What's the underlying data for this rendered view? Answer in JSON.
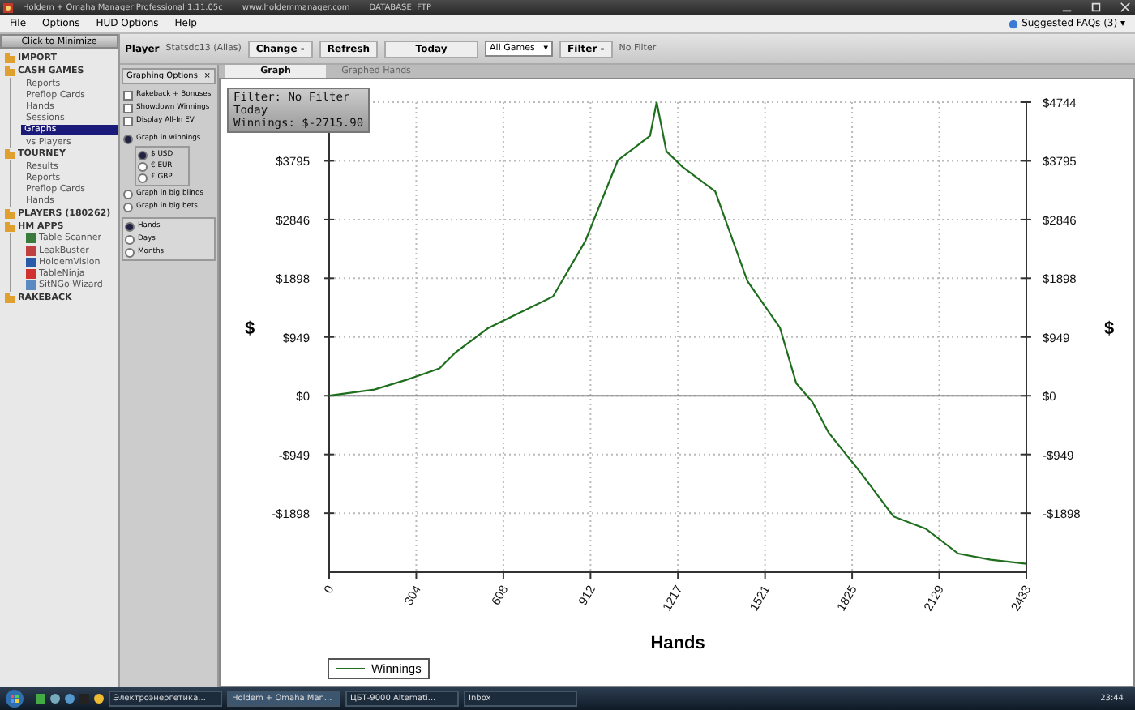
{
  "window": {
    "title": "Holdem + Omaha Manager Professional 1.11.05c",
    "site": "www.holdemmanager.com",
    "database": "DATABASE: FTP"
  },
  "menu": [
    "File",
    "Options",
    "HUD Options",
    "Help"
  ],
  "faq": "Suggested FAQs (3)",
  "faq_arrow": "▾",
  "minimize_button": "Click to Minimize",
  "sidebar": [
    {
      "label": "IMPORT"
    },
    {
      "label": "CASH GAMES",
      "children": [
        {
          "label": "Reports",
          "selected": false
        },
        {
          "label": "Preflop Cards",
          "selected": false
        },
        {
          "label": "Hands",
          "selected": false
        },
        {
          "label": "Sessions",
          "selected": false
        },
        {
          "label": "Graphs",
          "selected": true
        },
        {
          "label": "vs Players",
          "selected": false
        }
      ]
    },
    {
      "label": "TOURNEY",
      "children": [
        {
          "label": "Results",
          "selected": false
        },
        {
          "label": "Reports",
          "selected": false
        },
        {
          "label": "Preflop Cards",
          "selected": false
        },
        {
          "label": "Hands",
          "selected": false
        }
      ]
    },
    {
      "label": "PLAYERS (180262)"
    },
    {
      "label": "HM APPS",
      "children": [
        {
          "label": "Table Scanner",
          "selected": false,
          "color": "#3a7a3a"
        },
        {
          "label": "LeakBuster",
          "selected": false,
          "color": "#c04040"
        },
        {
          "label": "HoldemVision",
          "selected": false,
          "color": "#2a5aa8"
        },
        {
          "label": "TableNinja",
          "selected": false,
          "color": "#d03030"
        },
        {
          "label": "SitNGo Wizard",
          "selected": false,
          "color": "#5a8ac0"
        }
      ]
    },
    {
      "label": "RAKEBACK"
    }
  ],
  "toolbar": {
    "player_label": "Player",
    "player": "Statsdc13 (Alias)",
    "change": "Change -",
    "refresh": "Refresh",
    "today": "Today",
    "games": "All Games",
    "games_arrow": "▾",
    "filter": "Filter -",
    "filter_value": "No Filter"
  },
  "options": {
    "title": "Graphing Options",
    "close": "×",
    "checks": [
      {
        "label": "Rakeback + Bonuses",
        "checked": false
      },
      {
        "label": "Showdown Winnings",
        "checked": false
      },
      {
        "label": "Display All-In EV",
        "checked": false
      }
    ],
    "modes": [
      {
        "label": "Graph in winnings",
        "selected": true,
        "currencies": [
          {
            "label": "$ USD",
            "selected": true
          },
          {
            "label": "€ EUR",
            "selected": false
          },
          {
            "label": "£ GBP",
            "selected": false
          }
        ]
      },
      {
        "label": "Graph in big blinds",
        "selected": false
      },
      {
        "label": "Graph in big bets",
        "selected": false
      }
    ],
    "periods": [
      {
        "label": "Hands",
        "selected": true
      },
      {
        "label": "Days",
        "selected": false
      },
      {
        "label": "Months",
        "selected": false
      }
    ]
  },
  "tabs": [
    {
      "label": "Graph",
      "selected": true
    },
    {
      "label": "Graphed Hands",
      "selected": false
    }
  ],
  "info": [
    "Filter: No Filter",
    "Today",
    "Winnings: $-2715.90"
  ],
  "chart_data": {
    "type": "line",
    "xlabel": "Hands",
    "ylabel": "$",
    "x": [
      0,
      158,
      272,
      385,
      441,
      554,
      668,
      781,
      894,
      1007,
      1120,
      1143,
      1177,
      1233,
      1347,
      1460,
      1573,
      1630,
      1686,
      1743,
      1856,
      1969,
      2082,
      2195,
      2308,
      2433
    ],
    "series": [
      {
        "name": "Winnings",
        "color": "#1e6e1e",
        "values": [
          0,
          100,
          260,
          440,
          700,
          1090,
          1350,
          1600,
          2500,
          3800,
          4200,
          4744,
          3950,
          3700,
          3300,
          1850,
          1100,
          200,
          -100,
          -600,
          -1250,
          -1950,
          -2150,
          -2550,
          -2650,
          -2716
        ]
      }
    ],
    "grid": true,
    "xlim": [
      0,
      2433
    ],
    "ylim": [
      -2852,
      4744
    ],
    "xticks": [
      0,
      304,
      608,
      912,
      1217,
      1521,
      1825,
      2129,
      2433
    ],
    "yticks": [
      {
        "value": 4744,
        "label": "$4744"
      },
      {
        "value": 3795,
        "label": "$3795"
      },
      {
        "value": 2846,
        "label": "$2846"
      },
      {
        "value": 1898,
        "label": "$1898"
      },
      {
        "value": 949,
        "label": "$949"
      },
      {
        "value": 0,
        "label": "$0"
      },
      {
        "value": -949,
        "label": "-$949"
      },
      {
        "value": -1898,
        "label": "-$1898"
      }
    ]
  },
  "taskbar": {
    "tasks": [
      {
        "label": "Электроэнергетика...",
        "selected": false
      },
      {
        "label": "Holdem + Omaha Man...",
        "selected": true
      },
      {
        "label": "ЦБТ-9000 Alternati...",
        "selected": false
      },
      {
        "label": "Inbox",
        "selected": false
      }
    ],
    "clock": "23:44"
  }
}
